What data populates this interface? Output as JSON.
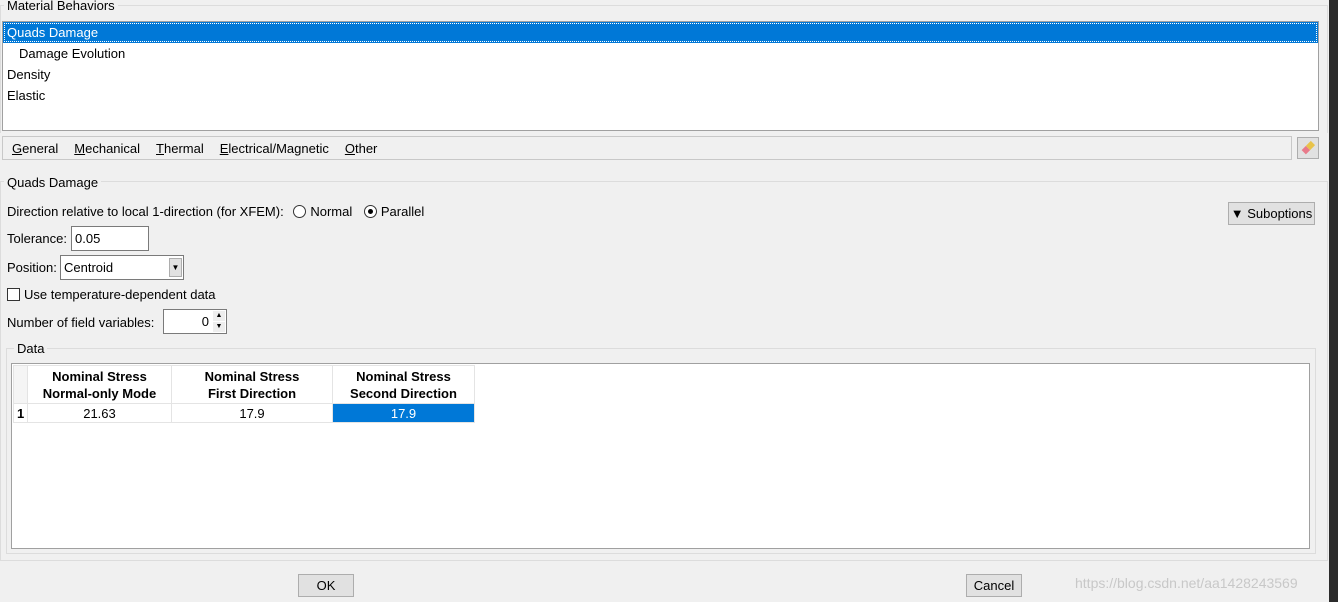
{
  "behaviors": {
    "title": "Material Behaviors",
    "items": [
      {
        "label": "Quads Damage",
        "selected": true,
        "indent": false
      },
      {
        "label": "Damage Evolution",
        "selected": false,
        "indent": true
      },
      {
        "label": "Density",
        "selected": false,
        "indent": false
      },
      {
        "label": "Elastic",
        "selected": false,
        "indent": false
      }
    ]
  },
  "tabs": [
    {
      "first": "G",
      "rest": "eneral"
    },
    {
      "first": "M",
      "rest": "echanical"
    },
    {
      "first": "T",
      "rest": "hermal"
    },
    {
      "first": "E",
      "rest": "lectrical/Magnetic"
    },
    {
      "first": "O",
      "rest": "ther"
    }
  ],
  "eraser_icon": "eraser-icon",
  "section": {
    "title": "Quads Damage",
    "direction_label": "Direction relative to local 1-direction (for XFEM):",
    "direction_options": [
      "Normal",
      "Parallel"
    ],
    "direction_selected": "Parallel",
    "suboptions_label": "Suboptions",
    "tolerance_label": "Tolerance:",
    "tolerance_value": "0.05",
    "position_label": "Position:",
    "position_value": "Centroid",
    "temp_label": "Use temperature-dependent data",
    "temp_checked": false,
    "field_vars_label": "Number of field variables:",
    "field_vars_value": "0"
  },
  "data": {
    "title": "Data",
    "columns": [
      [
        "Nominal Stress",
        "Normal-only Mode"
      ],
      [
        "Nominal Stress",
        "First Direction"
      ],
      [
        "Nominal Stress",
        "Second Direction"
      ]
    ],
    "rows": [
      {
        "index": "1",
        "values": [
          "21.63",
          "17.9",
          "17.9"
        ]
      }
    ]
  },
  "footer": {
    "ok": "OK",
    "cancel": "Cancel"
  },
  "watermark": "https://blog.csdn.net/aa1428243569",
  "colors": {
    "selection": "#0078d7"
  }
}
